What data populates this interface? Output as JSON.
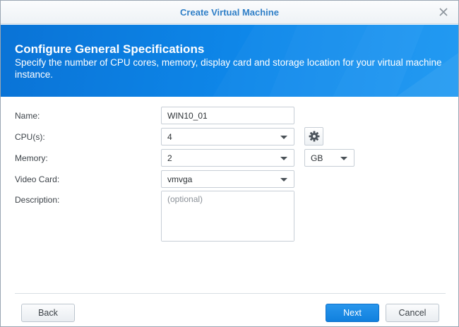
{
  "window": {
    "title": "Create Virtual Machine",
    "close_icon": "close-icon"
  },
  "banner": {
    "heading": "Configure General Specifications",
    "description": "Specify the number of CPU cores, memory, display card and storage location for your virtual machine instance."
  },
  "form": {
    "name": {
      "label": "Name:",
      "value": "WIN10_01"
    },
    "cpu": {
      "label": "CPU(s):",
      "value": "4",
      "settings_icon": "gear-icon"
    },
    "memory": {
      "label": "Memory:",
      "value": "2",
      "unit": "GB"
    },
    "video_card": {
      "label": "Video Card:",
      "value": "vmvga"
    },
    "description": {
      "label": "Description:",
      "placeholder": "(optional)",
      "value": ""
    }
  },
  "footer": {
    "back_label": "Back",
    "next_label": "Next",
    "cancel_label": "Cancel"
  },
  "colors": {
    "accent": "#1080de",
    "title_text": "#2f7fc7",
    "banner_start": "#0a73d6",
    "banner_end": "#1996f2"
  }
}
